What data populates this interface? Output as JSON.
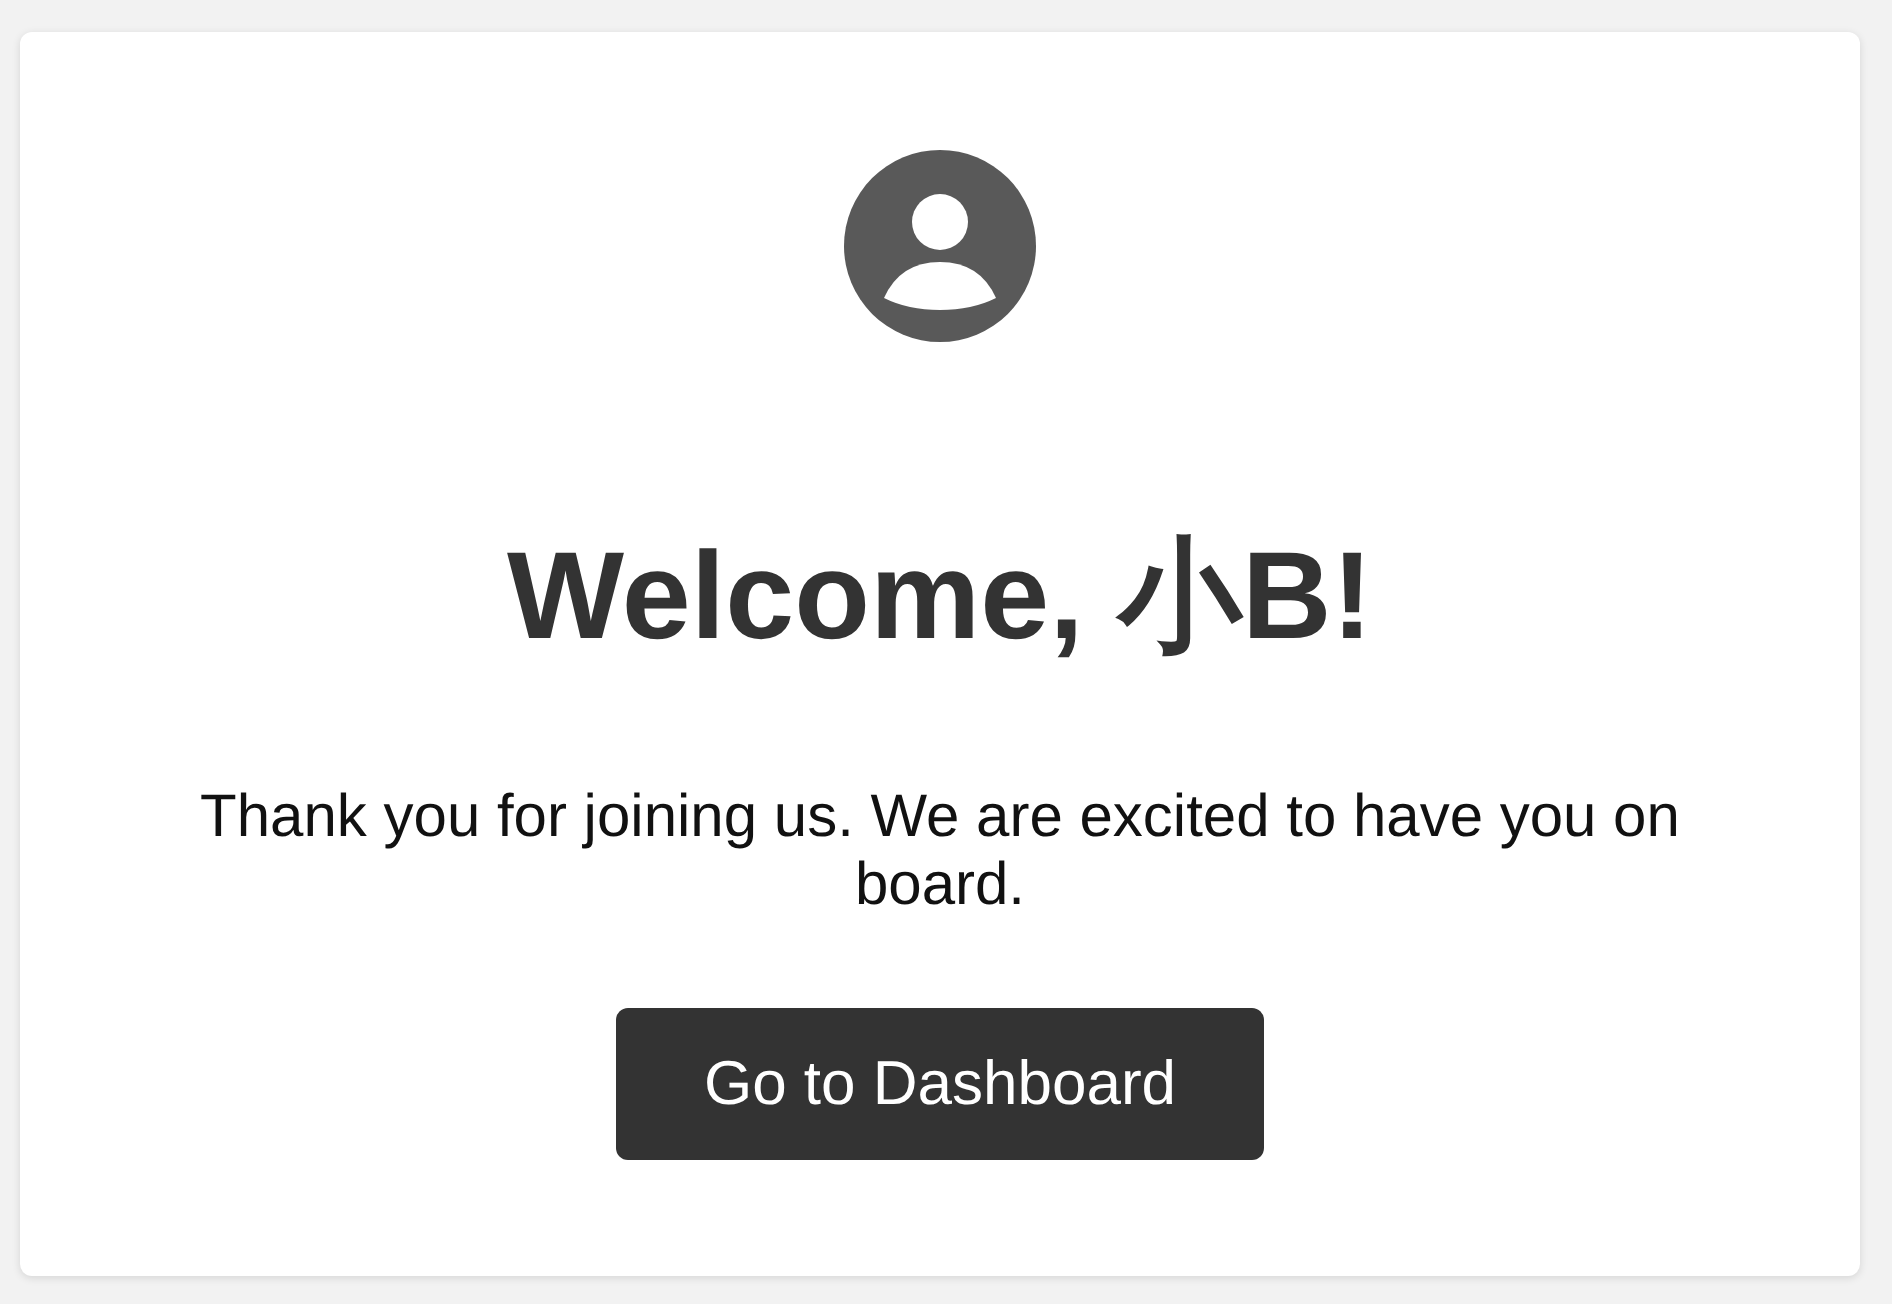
{
  "heading": "Welcome, 小B!",
  "message": "Thank you for joining us. We are excited to have you on board.",
  "primary_button": {
    "label": "Go to Dashboard"
  }
}
